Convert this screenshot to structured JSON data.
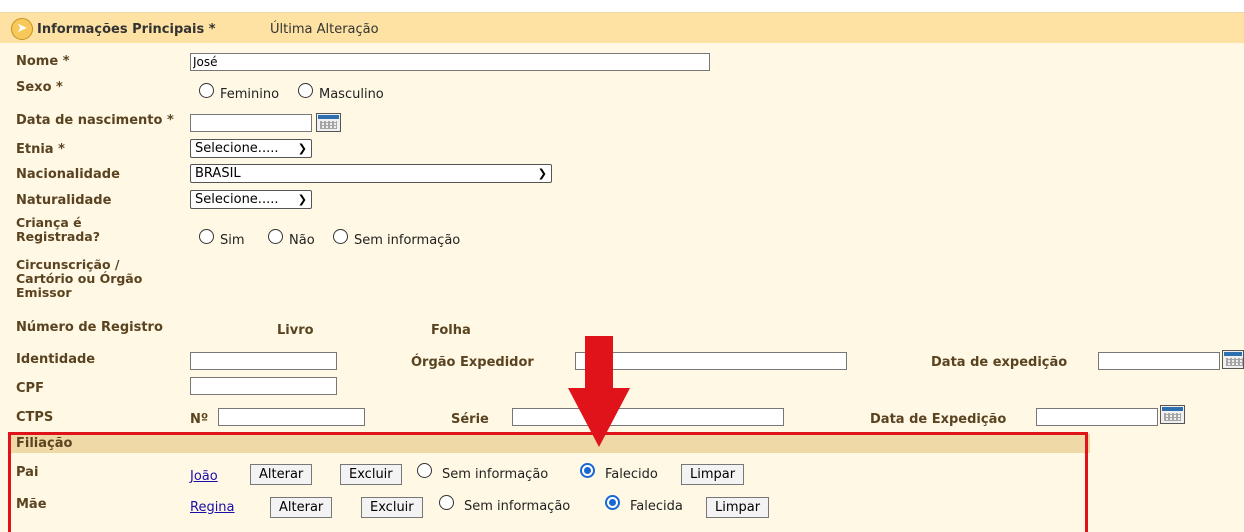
{
  "header": {
    "title": "Informações Principais *",
    "last_change": "Última Alteração"
  },
  "fields": {
    "nome": {
      "label": "Nome *",
      "value": "José"
    },
    "sexo": {
      "label": "Sexo *",
      "options": [
        "Feminino",
        "Masculino"
      ]
    },
    "data_nascimento": {
      "label": "Data de nascimento *",
      "value": ""
    },
    "etnia": {
      "label": "Etnia *",
      "selected": "Selecione....."
    },
    "nacionalidade": {
      "label": "Nacionalidade",
      "selected": "BRASIL"
    },
    "naturalidade": {
      "label": "Naturalidade",
      "selected": "Selecione....."
    },
    "crianca_registrada": {
      "label_line1": "Criança é",
      "label_line2": "Registrada?",
      "options": [
        "Sim",
        "Não",
        "Sem informação"
      ]
    },
    "circunscricao": {
      "line1": "Circunscrição /",
      "line2": "Cartório ou Órgão",
      "line3": "Emissor"
    },
    "numero_registro": {
      "label": "Número de Registro",
      "livro": "Livro",
      "folha": "Folha"
    },
    "identidade": {
      "label": "Identidade",
      "orgao_expedidor": "Órgão Expedidor",
      "data_expedicao": "Data de expedição"
    },
    "cpf": {
      "label": "CPF"
    },
    "ctps": {
      "label": "CTPS",
      "numero": "Nº",
      "serie": "Série",
      "data_expedicao": "Data de Expedição"
    }
  },
  "filiacao": {
    "title": "Filiação",
    "pai": {
      "label": "Pai",
      "name": "João",
      "alterar": "Alterar",
      "excluir": "Excluir",
      "sem_info": "Sem informação",
      "falecido": "Falecido",
      "limpar": "Limpar"
    },
    "mae": {
      "label": "Mãe",
      "name": "Regina",
      "alterar": "Alterar",
      "excluir": "Excluir",
      "sem_info": "Sem informação",
      "falecido": "Falecida",
      "limpar": "Limpar"
    }
  },
  "colors": {
    "background": "#fff8e4",
    "header": "#fde2a3",
    "label": "#5a4320",
    "highlight": "#e0131b",
    "radio_checked": "#1967d2"
  }
}
